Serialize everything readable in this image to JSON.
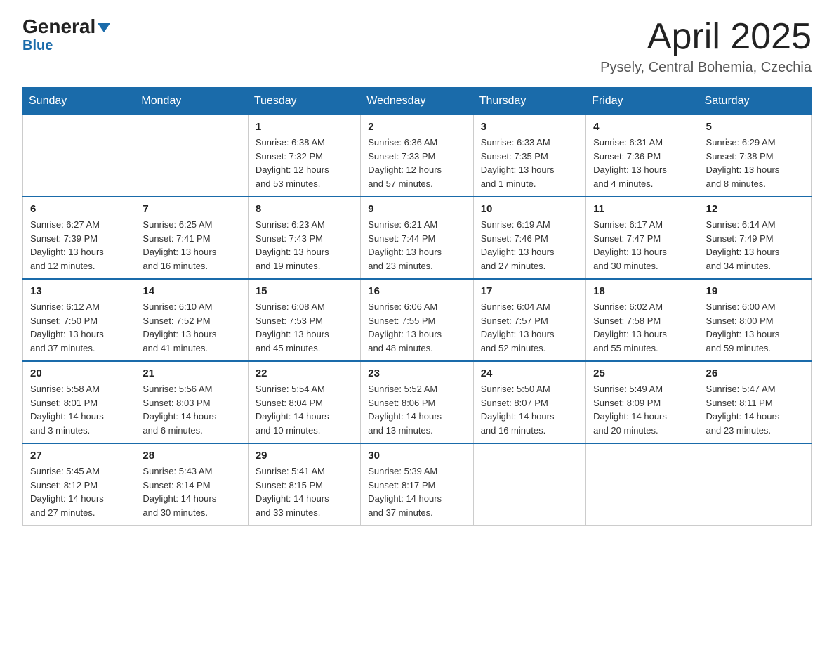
{
  "header": {
    "logo_general": "General",
    "logo_blue": "Blue",
    "month_year": "April 2025",
    "location": "Pysely, Central Bohemia, Czechia"
  },
  "days_of_week": [
    "Sunday",
    "Monday",
    "Tuesday",
    "Wednesday",
    "Thursday",
    "Friday",
    "Saturday"
  ],
  "weeks": [
    [
      {
        "day": "",
        "info": ""
      },
      {
        "day": "",
        "info": ""
      },
      {
        "day": "1",
        "info": "Sunrise: 6:38 AM\nSunset: 7:32 PM\nDaylight: 12 hours\nand 53 minutes."
      },
      {
        "day": "2",
        "info": "Sunrise: 6:36 AM\nSunset: 7:33 PM\nDaylight: 12 hours\nand 57 minutes."
      },
      {
        "day": "3",
        "info": "Sunrise: 6:33 AM\nSunset: 7:35 PM\nDaylight: 13 hours\nand 1 minute."
      },
      {
        "day": "4",
        "info": "Sunrise: 6:31 AM\nSunset: 7:36 PM\nDaylight: 13 hours\nand 4 minutes."
      },
      {
        "day": "5",
        "info": "Sunrise: 6:29 AM\nSunset: 7:38 PM\nDaylight: 13 hours\nand 8 minutes."
      }
    ],
    [
      {
        "day": "6",
        "info": "Sunrise: 6:27 AM\nSunset: 7:39 PM\nDaylight: 13 hours\nand 12 minutes."
      },
      {
        "day": "7",
        "info": "Sunrise: 6:25 AM\nSunset: 7:41 PM\nDaylight: 13 hours\nand 16 minutes."
      },
      {
        "day": "8",
        "info": "Sunrise: 6:23 AM\nSunset: 7:43 PM\nDaylight: 13 hours\nand 19 minutes."
      },
      {
        "day": "9",
        "info": "Sunrise: 6:21 AM\nSunset: 7:44 PM\nDaylight: 13 hours\nand 23 minutes."
      },
      {
        "day": "10",
        "info": "Sunrise: 6:19 AM\nSunset: 7:46 PM\nDaylight: 13 hours\nand 27 minutes."
      },
      {
        "day": "11",
        "info": "Sunrise: 6:17 AM\nSunset: 7:47 PM\nDaylight: 13 hours\nand 30 minutes."
      },
      {
        "day": "12",
        "info": "Sunrise: 6:14 AM\nSunset: 7:49 PM\nDaylight: 13 hours\nand 34 minutes."
      }
    ],
    [
      {
        "day": "13",
        "info": "Sunrise: 6:12 AM\nSunset: 7:50 PM\nDaylight: 13 hours\nand 37 minutes."
      },
      {
        "day": "14",
        "info": "Sunrise: 6:10 AM\nSunset: 7:52 PM\nDaylight: 13 hours\nand 41 minutes."
      },
      {
        "day": "15",
        "info": "Sunrise: 6:08 AM\nSunset: 7:53 PM\nDaylight: 13 hours\nand 45 minutes."
      },
      {
        "day": "16",
        "info": "Sunrise: 6:06 AM\nSunset: 7:55 PM\nDaylight: 13 hours\nand 48 minutes."
      },
      {
        "day": "17",
        "info": "Sunrise: 6:04 AM\nSunset: 7:57 PM\nDaylight: 13 hours\nand 52 minutes."
      },
      {
        "day": "18",
        "info": "Sunrise: 6:02 AM\nSunset: 7:58 PM\nDaylight: 13 hours\nand 55 minutes."
      },
      {
        "day": "19",
        "info": "Sunrise: 6:00 AM\nSunset: 8:00 PM\nDaylight: 13 hours\nand 59 minutes."
      }
    ],
    [
      {
        "day": "20",
        "info": "Sunrise: 5:58 AM\nSunset: 8:01 PM\nDaylight: 14 hours\nand 3 minutes."
      },
      {
        "day": "21",
        "info": "Sunrise: 5:56 AM\nSunset: 8:03 PM\nDaylight: 14 hours\nand 6 minutes."
      },
      {
        "day": "22",
        "info": "Sunrise: 5:54 AM\nSunset: 8:04 PM\nDaylight: 14 hours\nand 10 minutes."
      },
      {
        "day": "23",
        "info": "Sunrise: 5:52 AM\nSunset: 8:06 PM\nDaylight: 14 hours\nand 13 minutes."
      },
      {
        "day": "24",
        "info": "Sunrise: 5:50 AM\nSunset: 8:07 PM\nDaylight: 14 hours\nand 16 minutes."
      },
      {
        "day": "25",
        "info": "Sunrise: 5:49 AM\nSunset: 8:09 PM\nDaylight: 14 hours\nand 20 minutes."
      },
      {
        "day": "26",
        "info": "Sunrise: 5:47 AM\nSunset: 8:11 PM\nDaylight: 14 hours\nand 23 minutes."
      }
    ],
    [
      {
        "day": "27",
        "info": "Sunrise: 5:45 AM\nSunset: 8:12 PM\nDaylight: 14 hours\nand 27 minutes."
      },
      {
        "day": "28",
        "info": "Sunrise: 5:43 AM\nSunset: 8:14 PM\nDaylight: 14 hours\nand 30 minutes."
      },
      {
        "day": "29",
        "info": "Sunrise: 5:41 AM\nSunset: 8:15 PM\nDaylight: 14 hours\nand 33 minutes."
      },
      {
        "day": "30",
        "info": "Sunrise: 5:39 AM\nSunset: 8:17 PM\nDaylight: 14 hours\nand 37 minutes."
      },
      {
        "day": "",
        "info": ""
      },
      {
        "day": "",
        "info": ""
      },
      {
        "day": "",
        "info": ""
      }
    ]
  ]
}
